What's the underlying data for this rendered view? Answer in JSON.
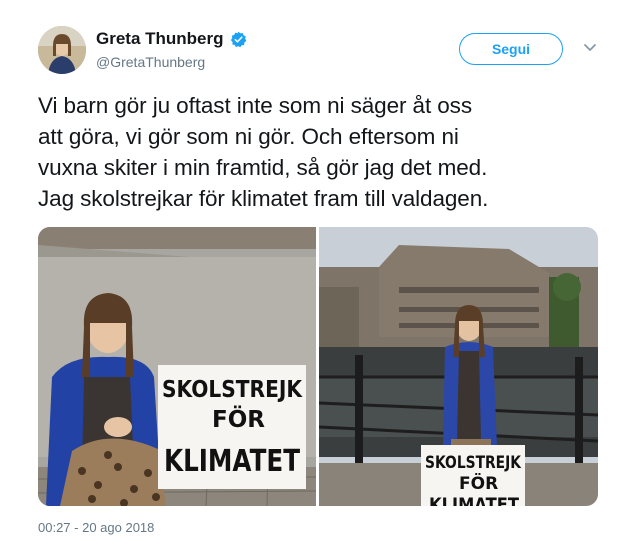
{
  "author": {
    "name": "Greta Thunberg",
    "handle": "@GretaThunberg"
  },
  "follow_label": "Segui",
  "tweet": {
    "lines": [
      "Vi barn gör ju oftast inte som ni säger åt oss",
      "att göra, vi gör som ni gör. Och eftersom ni",
      "vuxna skiter i min framtid, så gör jag det med.",
      "Jag skolstrejkar för klimatet fram till valdagen."
    ]
  },
  "photos": {
    "left_sign": [
      "SKOLSTREJK",
      "FÖR",
      "KLIMATET"
    ],
    "right_sign": [
      "SKOLSTREJK",
      "FÖR",
      "KLIMATET"
    ]
  },
  "timestamp": "00:27 - 20 ago 2018",
  "icons": {
    "verified": "verified-badge-icon",
    "caret": "chevron-down-icon"
  },
  "colors": {
    "accent": "#1da1f2",
    "muted": "#657786",
    "text": "#14171a"
  }
}
